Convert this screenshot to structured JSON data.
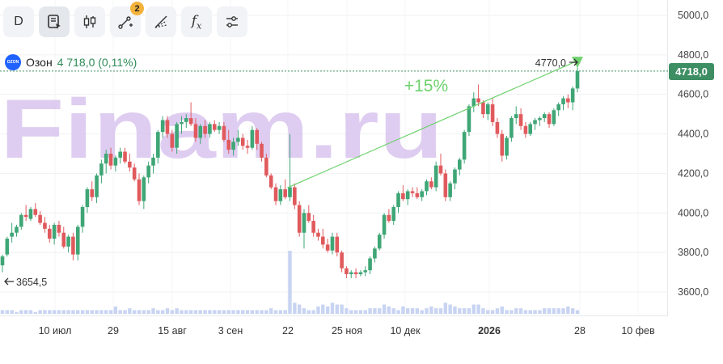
{
  "toolbar": {
    "interval_label": "D",
    "draw_badge": "2",
    "fx_label": "f",
    "fx_sub": "x"
  },
  "ticker": {
    "name": "Озон",
    "price_change": "4 718,0 (0,11%)"
  },
  "watermark": "Finam.ru",
  "colors": {
    "up": "#3fa676",
    "down": "#e05a5d",
    "accent_line": "#6ed26e",
    "price_badge": "#3e8e63",
    "volume": "#c8d4f2",
    "watermark": "#d9c4ef"
  },
  "labels": {
    "current_price": "4718,0",
    "target_price": "4770,0",
    "left_marker": "3654,5",
    "percent": "+15%"
  },
  "chart_data": {
    "type": "candlestick",
    "y_range": [
      3525,
      5075
    ],
    "y_ticks": [
      "5000,0",
      "4800,0",
      "4600,0",
      "4400,0",
      "4200,0",
      "4000,0",
      "3800,0",
      "3600,0"
    ],
    "x_ticks": [
      "10 июл",
      "29",
      "15 авг",
      "3 сен",
      "22",
      "25 ноя",
      "10 дек",
      "2026",
      "28",
      "10 фев"
    ],
    "current_price": 4718,
    "line_from": [
      4128,
      4770
    ],
    "ohlc": [
      [
        3735,
        3790,
        3700,
        3780
      ],
      [
        3790,
        3880,
        3780,
        3870
      ],
      [
        3880,
        3950,
        3850,
        3900
      ],
      [
        3900,
        3940,
        3880,
        3930
      ],
      [
        3930,
        4000,
        3915,
        3990
      ],
      [
        3990,
        4040,
        3960,
        3980
      ],
      [
        3970,
        4030,
        3960,
        4020
      ],
      [
        4020,
        4050,
        3980,
        3990
      ],
      [
        3990,
        4010,
        3940,
        3950
      ],
      [
        3950,
        3980,
        3900,
        3920
      ],
      [
        3920,
        3940,
        3850,
        3870
      ],
      [
        3870,
        3950,
        3840,
        3940
      ],
      [
        3940,
        3960,
        3880,
        3900
      ],
      [
        3900,
        3930,
        3820,
        3830
      ],
      [
        3830,
        3890,
        3800,
        3880
      ],
      [
        3880,
        3900,
        3760,
        3790
      ],
      [
        3790,
        3940,
        3760,
        3930
      ],
      [
        3930,
        4040,
        3900,
        4030
      ],
      [
        4030,
        4130,
        4000,
        4120
      ],
      [
        4120,
        4160,
        4060,
        4080
      ],
      [
        4080,
        4200,
        4050,
        4190
      ],
      [
        4190,
        4270,
        4150,
        4250
      ],
      [
        4250,
        4320,
        4200,
        4300
      ],
      [
        4300,
        4330,
        4220,
        4240
      ],
      [
        4240,
        4290,
        4210,
        4280
      ],
      [
        4280,
        4330,
        4250,
        4310
      ],
      [
        4310,
        4330,
        4250,
        4260
      ],
      [
        4260,
        4300,
        4210,
        4230
      ],
      [
        4230,
        4250,
        4160,
        4170
      ],
      [
        4170,
        4200,
        4040,
        4060
      ],
      [
        4060,
        4190,
        4020,
        4180
      ],
      [
        4180,
        4260,
        4150,
        4240
      ],
      [
        4240,
        4300,
        4200,
        4280
      ],
      [
        4280,
        4420,
        4250,
        4410
      ],
      [
        4410,
        4490,
        4380,
        4470
      ],
      [
        4470,
        4490,
        4380,
        4400
      ],
      [
        4400,
        4420,
        4310,
        4330
      ],
      [
        4330,
        4460,
        4300,
        4450
      ],
      [
        4450,
        4490,
        4400,
        4460
      ],
      [
        4460,
        4500,
        4430,
        4480
      ],
      [
        4480,
        4560,
        4440,
        4450
      ],
      [
        4450,
        4480,
        4360,
        4380
      ],
      [
        4380,
        4450,
        4350,
        4440
      ],
      [
        4440,
        4470,
        4380,
        4400
      ],
      [
        4400,
        4460,
        4380,
        4450
      ],
      [
        4450,
        4470,
        4410,
        4420
      ],
      [
        4420,
        4460,
        4400,
        4440
      ],
      [
        4440,
        4460,
        4360,
        4370
      ],
      [
        4370,
        4420,
        4300,
        4320
      ],
      [
        4320,
        4380,
        4290,
        4360
      ],
      [
        4360,
        4420,
        4340,
        4380
      ],
      [
        4380,
        4400,
        4320,
        4340
      ],
      [
        4340,
        4370,
        4300,
        4330
      ],
      [
        4330,
        4440,
        4320,
        4420
      ],
      [
        4420,
        4430,
        4320,
        4350
      ],
      [
        4350,
        4360,
        4260,
        4280
      ],
      [
        4280,
        4300,
        4180,
        4190
      ],
      [
        4190,
        4200,
        4120,
        4130
      ],
      [
        4130,
        4150,
        4040,
        4060
      ],
      [
        4060,
        4140,
        4040,
        4120
      ],
      [
        4120,
        4170,
        4070,
        4080
      ],
      [
        4080,
        4400,
        4060,
        4130
      ],
      [
        4130,
        4150,
        4020,
        4040
      ],
      [
        4040,
        4060,
        3880,
        3900
      ],
      [
        3900,
        4020,
        3820,
        4000
      ],
      [
        4000,
        4040,
        3950,
        3960
      ],
      [
        3960,
        3990,
        3880,
        3900
      ],
      [
        3900,
        3920,
        3860,
        3880
      ],
      [
        3880,
        3920,
        3820,
        3840
      ],
      [
        3840,
        3870,
        3800,
        3810
      ],
      [
        3810,
        3900,
        3790,
        3880
      ],
      [
        3880,
        3900,
        3780,
        3800
      ],
      [
        3800,
        3810,
        3700,
        3720
      ],
      [
        3720,
        3730,
        3670,
        3690
      ],
      [
        3690,
        3710,
        3670,
        3700
      ],
      [
        3700,
        3720,
        3670,
        3690
      ],
      [
        3690,
        3710,
        3680,
        3700
      ],
      [
        3700,
        3730,
        3680,
        3710
      ],
      [
        3710,
        3780,
        3690,
        3770
      ],
      [
        3770,
        3830,
        3750,
        3820
      ],
      [
        3820,
        3900,
        3810,
        3890
      ],
      [
        3890,
        4000,
        3870,
        3990
      ],
      [
        3990,
        4020,
        3950,
        3960
      ],
      [
        3960,
        4040,
        3940,
        4030
      ],
      [
        4030,
        4110,
        4000,
        4100
      ],
      [
        4100,
        4140,
        4060,
        4070
      ],
      [
        4070,
        4120,
        4040,
        4110
      ],
      [
        4110,
        4130,
        4080,
        4100
      ],
      [
        4100,
        4130,
        4070,
        4080
      ],
      [
        4080,
        4120,
        4060,
        4110
      ],
      [
        4110,
        4170,
        4090,
        4160
      ],
      [
        4160,
        4180,
        4120,
        4130
      ],
      [
        4130,
        4260,
        4110,
        4240
      ],
      [
        4240,
        4300,
        4190,
        4200
      ],
      [
        4200,
        4220,
        4060,
        4080
      ],
      [
        4080,
        4160,
        4060,
        4150
      ],
      [
        4150,
        4230,
        4120,
        4220
      ],
      [
        4220,
        4280,
        4190,
        4270
      ],
      [
        4270,
        4420,
        4250,
        4410
      ],
      [
        4410,
        4550,
        4390,
        4540
      ],
      [
        4540,
        4610,
        4510,
        4580
      ],
      [
        4580,
        4650,
        4540,
        4560
      ],
      [
        4560,
        4570,
        4480,
        4500
      ],
      [
        4500,
        4560,
        4470,
        4550
      ],
      [
        4550,
        4580,
        4440,
        4460
      ],
      [
        4460,
        4480,
        4380,
        4400
      ],
      [
        4400,
        4420,
        4260,
        4290
      ],
      [
        4290,
        4390,
        4270,
        4380
      ],
      [
        4380,
        4490,
        4360,
        4480
      ],
      [
        4480,
        4540,
        4450,
        4500
      ],
      [
        4500,
        4530,
        4420,
        4440
      ],
      [
        4440,
        4460,
        4380,
        4400
      ],
      [
        4400,
        4460,
        4390,
        4450
      ],
      [
        4450,
        4480,
        4420,
        4470
      ],
      [
        4470,
        4490,
        4440,
        4480
      ],
      [
        4480,
        4510,
        4460,
        4500
      ],
      [
        4500,
        4510,
        4430,
        4450
      ],
      [
        4450,
        4530,
        4440,
        4520
      ],
      [
        4520,
        4560,
        4490,
        4550
      ],
      [
        4550,
        4590,
        4520,
        4580
      ],
      [
        4580,
        4600,
        4530,
        4560
      ],
      [
        4560,
        4640,
        4520,
        4630
      ],
      [
        4630,
        4740,
        4610,
        4718
      ]
    ],
    "volume": [
      2,
      2,
      2,
      1,
      2,
      2,
      2,
      1,
      2,
      2,
      2,
      2,
      2,
      2,
      2,
      2,
      2,
      2,
      2,
      2,
      2,
      2,
      2,
      2,
      4,
      2,
      2,
      3,
      2,
      2,
      2,
      2,
      3,
      2,
      2,
      3,
      2,
      3,
      2,
      2,
      2,
      2,
      2,
      2,
      2,
      2,
      2,
      2,
      2,
      2,
      2,
      2,
      2,
      2,
      2,
      2,
      2,
      3,
      2,
      2,
      2,
      34,
      6,
      5,
      3,
      2,
      2,
      4,
      5,
      4,
      6,
      5,
      5,
      3,
      2,
      2,
      2,
      2,
      3,
      3,
      3,
      5,
      4,
      3,
      2,
      4,
      3,
      3,
      3,
      2,
      3,
      4,
      3,
      3,
      6,
      5,
      4,
      3,
      3,
      3,
      5,
      5,
      3,
      2,
      2,
      3,
      4,
      2,
      2,
      3,
      3,
      2,
      2,
      2,
      2,
      3,
      3,
      3,
      3,
      3,
      4,
      3,
      2
    ]
  }
}
